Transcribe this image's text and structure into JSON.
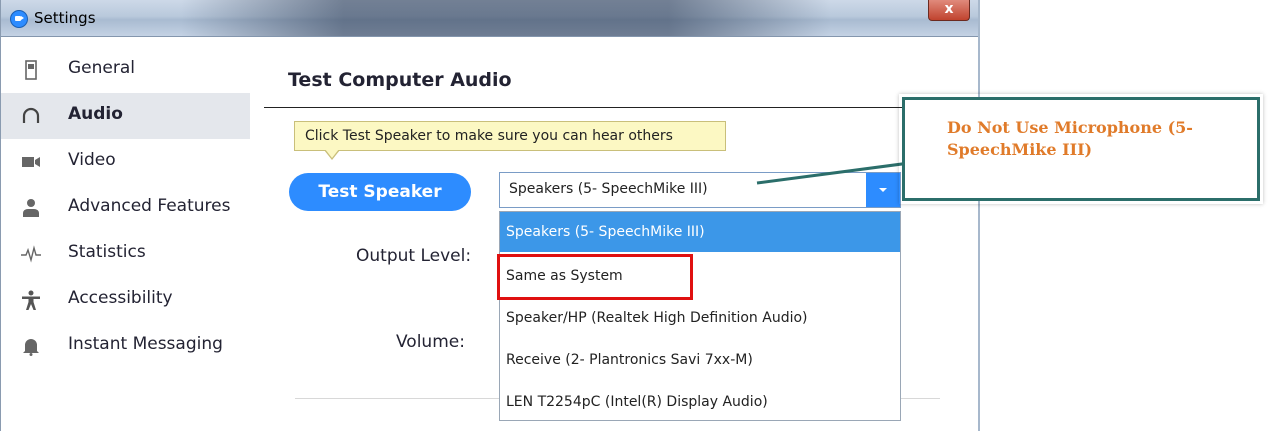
{
  "window": {
    "title": "Settings",
    "close_label": "x"
  },
  "sidebar": {
    "items": [
      {
        "label": "General",
        "icon": "general-icon",
        "active": false
      },
      {
        "label": "Audio",
        "icon": "headphones-icon",
        "active": true
      },
      {
        "label": "Video",
        "icon": "video-camera-icon",
        "active": false
      },
      {
        "label": "Advanced Features",
        "icon": "person-icon",
        "active": false
      },
      {
        "label": "Statistics",
        "icon": "pulse-icon",
        "active": false
      },
      {
        "label": "Accessibility",
        "icon": "accessibility-icon",
        "active": false
      },
      {
        "label": "Instant Messaging",
        "icon": "bell-icon",
        "active": false
      }
    ]
  },
  "main": {
    "title": "Test Computer Audio",
    "tooltip": "Click Test Speaker to make sure you can hear others",
    "test_speaker_label": "Test Speaker",
    "output_level_label": "Output Level:",
    "volume_label": "Volume:",
    "speaker_select": {
      "value": "Speakers (5- SpeechMike III)",
      "options": [
        "Speakers (5- SpeechMike III)",
        "Same as System",
        "Speaker/HP (Realtek High Definition Audio)",
        "Receive (2- Plantronics Savi 7xx-M)",
        "LEN T2254pC (Intel(R) Display Audio)"
      ],
      "selected_index": 0,
      "highlighted_option": "Same as System"
    }
  },
  "annotation": {
    "text": "Do Not Use Microphone (5-SpeechMike III)",
    "line1": "Do Not Use Microphone (5-",
    "line2": "SpeechMike III)",
    "text_color": "#e07b2a",
    "border_color": "#2b6e6a"
  },
  "colors": {
    "accent": "#2d8cff",
    "highlight_box": "#e01010"
  }
}
